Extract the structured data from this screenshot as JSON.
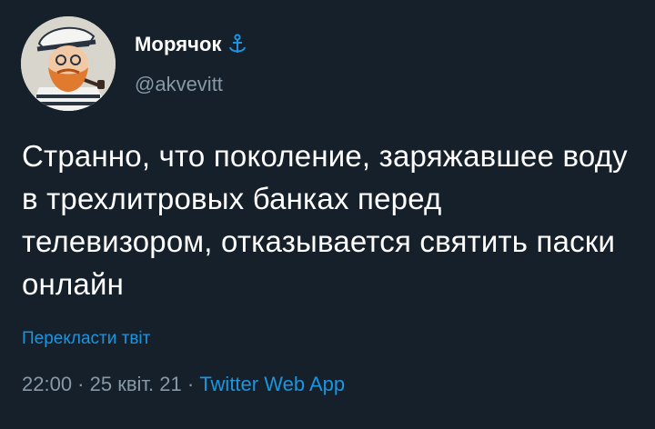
{
  "author": {
    "display_name": "Морячок",
    "handle": "@akvevitt",
    "verified_icon": "anchor-icon",
    "avatar_icon": "sailor-avatar"
  },
  "tweet": {
    "text": "Странно, что поколение, заряжавшее воду в трехлитровых банках перед телевизором, отказывается святить паски онлайн",
    "translate_label": "Перекласти твіт"
  },
  "meta": {
    "time": "22:00",
    "separator1": " · ",
    "date": "25 квіт. 21",
    "separator2": " · ",
    "source": "Twitter Web App"
  },
  "colors": {
    "background": "#15202b",
    "text": "#ffffff",
    "secondary": "#8899a6",
    "accent": "#1b95e0"
  }
}
